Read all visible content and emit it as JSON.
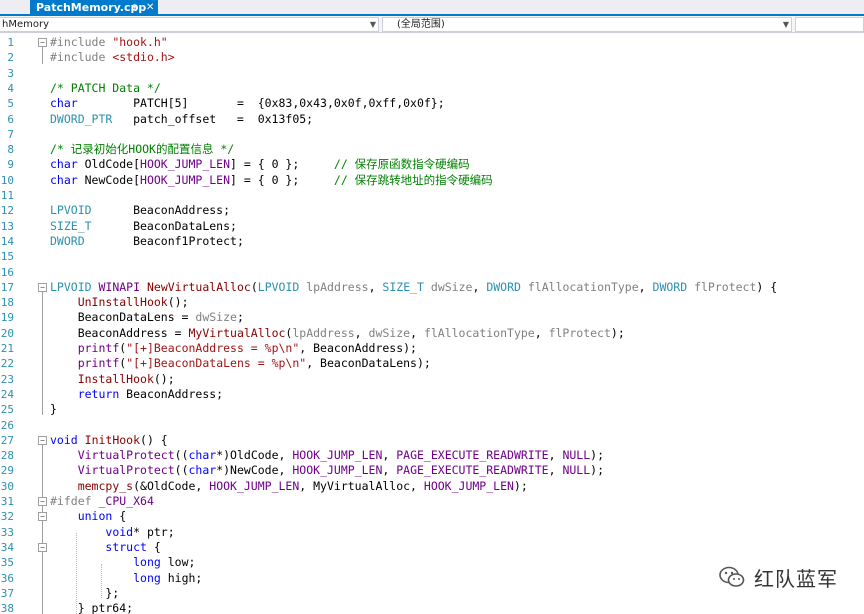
{
  "tab": {
    "title": "PatchMemory.cpp",
    "pin": "⊕",
    "close": "✕"
  },
  "navbar": {
    "scope_left": "hMemory",
    "scope_right": "(全局范围)"
  },
  "watermark": {
    "text": "红队蓝军"
  },
  "lines": [
    {
      "n": "1",
      "html": "<span class='pp'>#include</span> <span class='str'>\"hook.h\"</span>"
    },
    {
      "n": "2",
      "html": "<span class='pp'>#include</span> <span class='str'>&lt;stdio.h&gt;</span>"
    },
    {
      "n": "3",
      "html": ""
    },
    {
      "n": "4",
      "html": "<span class='cm'>/* PATCH Data */</span>"
    },
    {
      "n": "5",
      "html": "<span class='kw'>char</span>        PATCH[5]       =  {0x83,0x43,0x0f,0xff,0x0f};"
    },
    {
      "n": "6",
      "html": "<span class='ty'>DWORD_PTR</span>   patch_offset   =  0x13f05;"
    },
    {
      "n": "7",
      "html": ""
    },
    {
      "n": "8",
      "html": "<span class='cm'>/* 记录初始化HOOK的配置信息 */</span>"
    },
    {
      "n": "9",
      "html": "<span class='kw'>char</span> OldCode[<span class='mac'>HOOK_JUMP_LEN</span>] = { 0 };     <span class='cm'>// 保存原函数指令硬编码</span>"
    },
    {
      "n": "10",
      "html": "<span class='kw'>char</span> NewCode[<span class='mac'>HOOK_JUMP_LEN</span>] = { 0 };     <span class='cm'>// 保存跳转地址的指令硬编码</span>"
    },
    {
      "n": "11",
      "html": ""
    },
    {
      "n": "12",
      "html": "<span class='ty'>LPVOID</span>      BeaconAddress;"
    },
    {
      "n": "13",
      "html": "<span class='ty'>SIZE_T</span>      BeaconDataLens;"
    },
    {
      "n": "14",
      "html": "<span class='ty'>DWORD</span>       Beaconf1Protect;"
    },
    {
      "n": "15",
      "html": ""
    },
    {
      "n": "16",
      "html": ""
    },
    {
      "n": "17",
      "html": "<span class='ty'>LPVOID</span> <span class='mac'>WINAPI</span> <span class='fn'>NewVirtualAlloc</span>(<span class='ty'>LPVOID</span> <span class='param'>lpAddress</span>, <span class='ty'>SIZE_T</span> <span class='param'>dwSize</span>, <span class='ty'>DWORD</span> <span class='param'>flAllocationType</span>, <span class='ty'>DWORD</span> <span class='param'>flProtect</span>) {"
    },
    {
      "n": "18",
      "html": "    <span class='fn'>UnInstallHook</span>();"
    },
    {
      "n": "19",
      "html": "    BeaconDataLens = <span class='param'>dwSize</span>;"
    },
    {
      "n": "20",
      "html": "    BeaconAddress = <span class='fn'>MyVirtualAlloc</span>(<span class='param'>lpAddress</span>, <span class='param'>dwSize</span>, <span class='param'>flAllocationType</span>, <span class='param'>flProtect</span>);"
    },
    {
      "n": "21",
      "html": "    <span class='mac'>printf</span>(<span class='str'>\"[+]BeaconAddress = %p\\n\"</span>, BeaconAddress);"
    },
    {
      "n": "22",
      "html": "    <span class='mac'>printf</span>(<span class='str'>\"[+]BeaconDataLens = %p\\n\"</span>, BeaconDataLens);"
    },
    {
      "n": "23",
      "html": "    <span class='fn'>InstallHook</span>();"
    },
    {
      "n": "24",
      "html": "    <span class='kw'>return</span> BeaconAddress;"
    },
    {
      "n": "25",
      "html": "}"
    },
    {
      "n": "26",
      "html": ""
    },
    {
      "n": "27",
      "html": "<span class='kw'>void</span> <span class='fn'>InitHook</span>() {"
    },
    {
      "n": "28",
      "html": "    <span class='mac'>VirtualProtect</span>((<span class='kw'>char</span>*)OldCode, <span class='mac'>HOOK_JUMP_LEN</span>, <span class='mac'>PAGE_EXECUTE_READWRITE</span>, <span class='mac'>NULL</span>);"
    },
    {
      "n": "29",
      "html": "    <span class='mac'>VirtualProtect</span>((<span class='kw'>char</span>*)NewCode, <span class='mac'>HOOK_JUMP_LEN</span>, <span class='mac'>PAGE_EXECUTE_READWRITE</span>, <span class='mac'>NULL</span>);"
    },
    {
      "n": "30",
      "html": "    <span class='fn'>memcpy_s</span>(&amp;OldCode, <span class='mac'>HOOK_JUMP_LEN</span>, MyVirtualAlloc, <span class='mac'>HOOK_JUMP_LEN</span>);"
    },
    {
      "n": "31",
      "html": "<span class='pp'>#ifdef</span> <span class='mac'>_CPU_X64</span>"
    },
    {
      "n": "32",
      "html": "    <span class='kw'>union</span> {"
    },
    {
      "n": "33",
      "html": "        <span class='kw'>void</span>* ptr;"
    },
    {
      "n": "34",
      "html": "        <span class='kw'>struct</span> {"
    },
    {
      "n": "35",
      "html": "            <span class='kw'>long</span> low;"
    },
    {
      "n": "36",
      "html": "            <span class='kw'>long</span> high;"
    },
    {
      "n": "37",
      "html": "        };"
    },
    {
      "n": "38",
      "html": "    } ptr64;"
    }
  ]
}
